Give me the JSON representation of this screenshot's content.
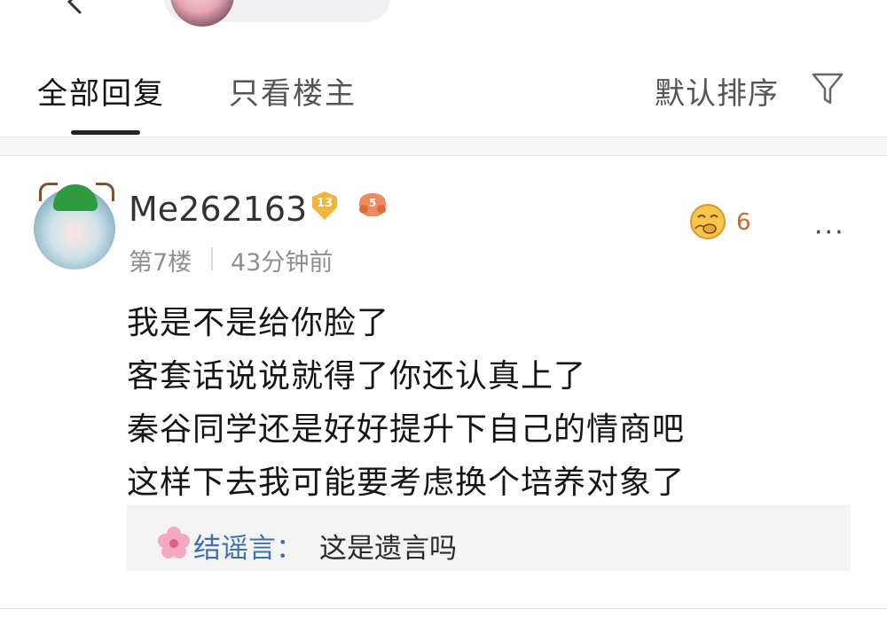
{
  "tabs": {
    "all_replies": "全部回复",
    "op_only": "只看楼主",
    "sort_label": "默认排序"
  },
  "comment": {
    "username": "Me262163",
    "level": "13",
    "fan_level": "5",
    "floor": "第7楼",
    "time": "43分钟前",
    "reaction_count": "6",
    "lines": [
      "我是不是给你脸了",
      "客套话说说就得了你还认真上了",
      "秦谷同学还是好好提升下自己的情商吧",
      "这样下去我可能要考虑换个培养对象了"
    ],
    "reply": {
      "name": "结谣言：",
      "text": "这是遗言吗"
    }
  },
  "colors": {
    "reply_name": "#3f6fb1",
    "meta": "#8f8f8f",
    "level_badge": "#f2b43a",
    "reaction": "#c9672f"
  },
  "icons": [
    "back-icon",
    "filter-icon",
    "level-badge-icon",
    "fan-badge-icon",
    "reaction-icon",
    "more-icon",
    "flower-icon"
  ]
}
